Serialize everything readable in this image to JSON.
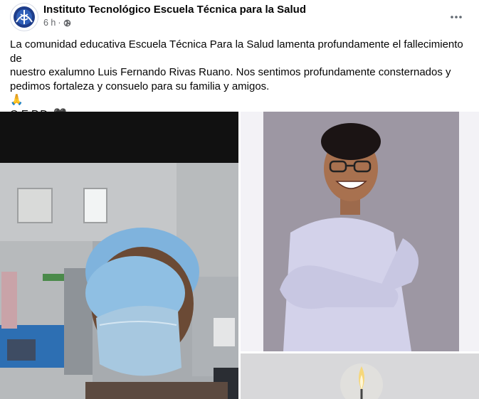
{
  "post": {
    "page_name": "Instituto Tecnológico Escuela Técnica para la Salud",
    "time": "6 h",
    "dot": "·",
    "text_lines": [
      "La comunidad educativa Escuela Técnica Para la Salud lamenta  profundamente el fallecimiento de",
      "nuestro exalumno Luis Fernando Rivas Ruano. Nos sentimos profundamente consternados y",
      "pedimos fortaleza y consuelo para su familia y amigos."
    ],
    "emoji_line": "🙏",
    "qepd": "Q.E.P.D. 🖤"
  },
  "icons": {
    "more": "more-options-icon",
    "globe": "globe-icon",
    "avatar": "page-logo"
  },
  "colors": {
    "text": "#050505",
    "secondary": "#65676b",
    "accent": "#1b74e4"
  }
}
